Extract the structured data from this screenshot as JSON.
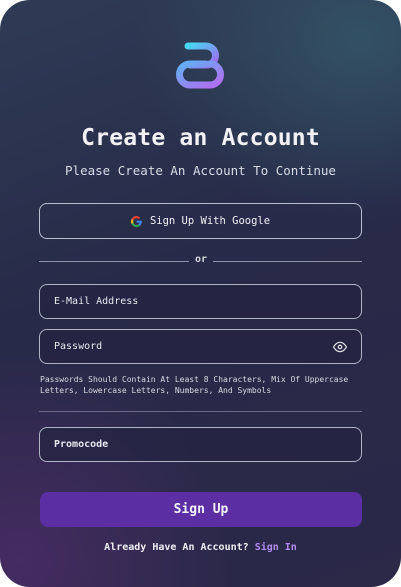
{
  "header": {
    "logo_icon": "brand-logo-icon",
    "title": "Create an Account",
    "subtitle": "Please Create An Account To Continue"
  },
  "google": {
    "label": "Sign Up With Google",
    "icon": "google-icon"
  },
  "divider": {
    "label": "or"
  },
  "form": {
    "email_placeholder": "E-Mail Address",
    "password_placeholder": "Password",
    "password_toggle_icon": "eye-icon",
    "password_hint": "Passwords Should Contain At Least 8 Characters, Mix Of Uppercase Letters, Lowercase Letters, Numbers, And Symbols",
    "promo_placeholder": "Promocode"
  },
  "actions": {
    "signup_label": "Sign Up"
  },
  "footer": {
    "prompt": "Already Have An Account?",
    "signin_label": "Sign In"
  },
  "colors": {
    "accent": "#5b2ea3",
    "link": "#b18bf0"
  }
}
